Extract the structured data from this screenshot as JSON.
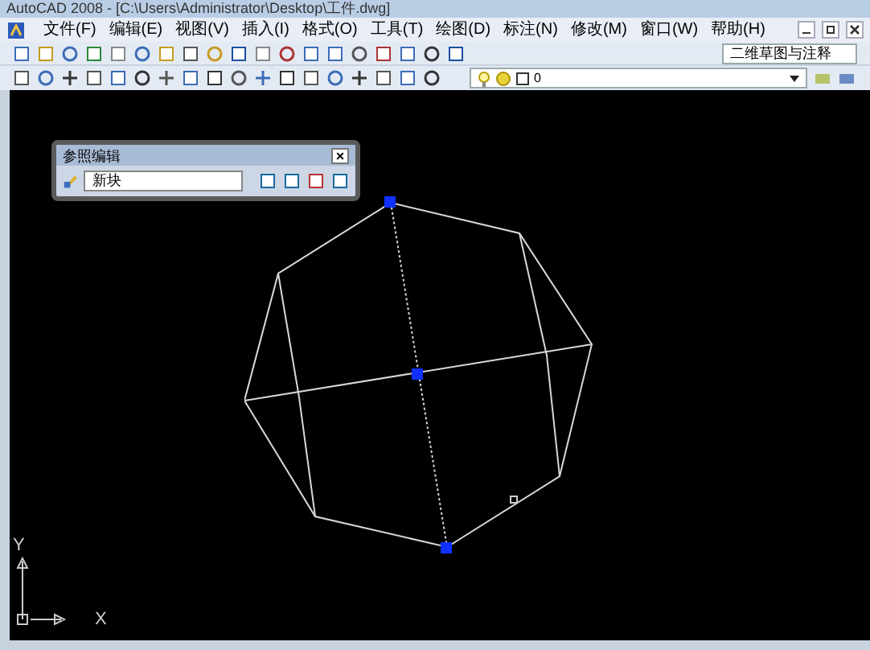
{
  "window": {
    "title": "AutoCAD 2008 - [C:\\Users\\Administrator\\Desktop\\工件.dwg]"
  },
  "menu_bar": {
    "items": [
      {
        "label": "文件(F)"
      },
      {
        "label": "编辑(E)"
      },
      {
        "label": "视图(V)"
      },
      {
        "label": "插入(I)"
      },
      {
        "label": "格式(O)"
      },
      {
        "label": "工具(T)"
      },
      {
        "label": "绘图(D)"
      },
      {
        "label": "标注(N)"
      },
      {
        "label": "修改(M)"
      },
      {
        "label": "窗口(W)"
      },
      {
        "label": "帮助(H)"
      }
    ]
  },
  "workspace": {
    "value": "二维草图与注释"
  },
  "layer": {
    "value": "0"
  },
  "refedit_panel": {
    "title": "参照编辑",
    "close": "×",
    "field": {
      "value": "新块"
    }
  },
  "ucs": {
    "x_label": "X",
    "y_label": "Y"
  }
}
